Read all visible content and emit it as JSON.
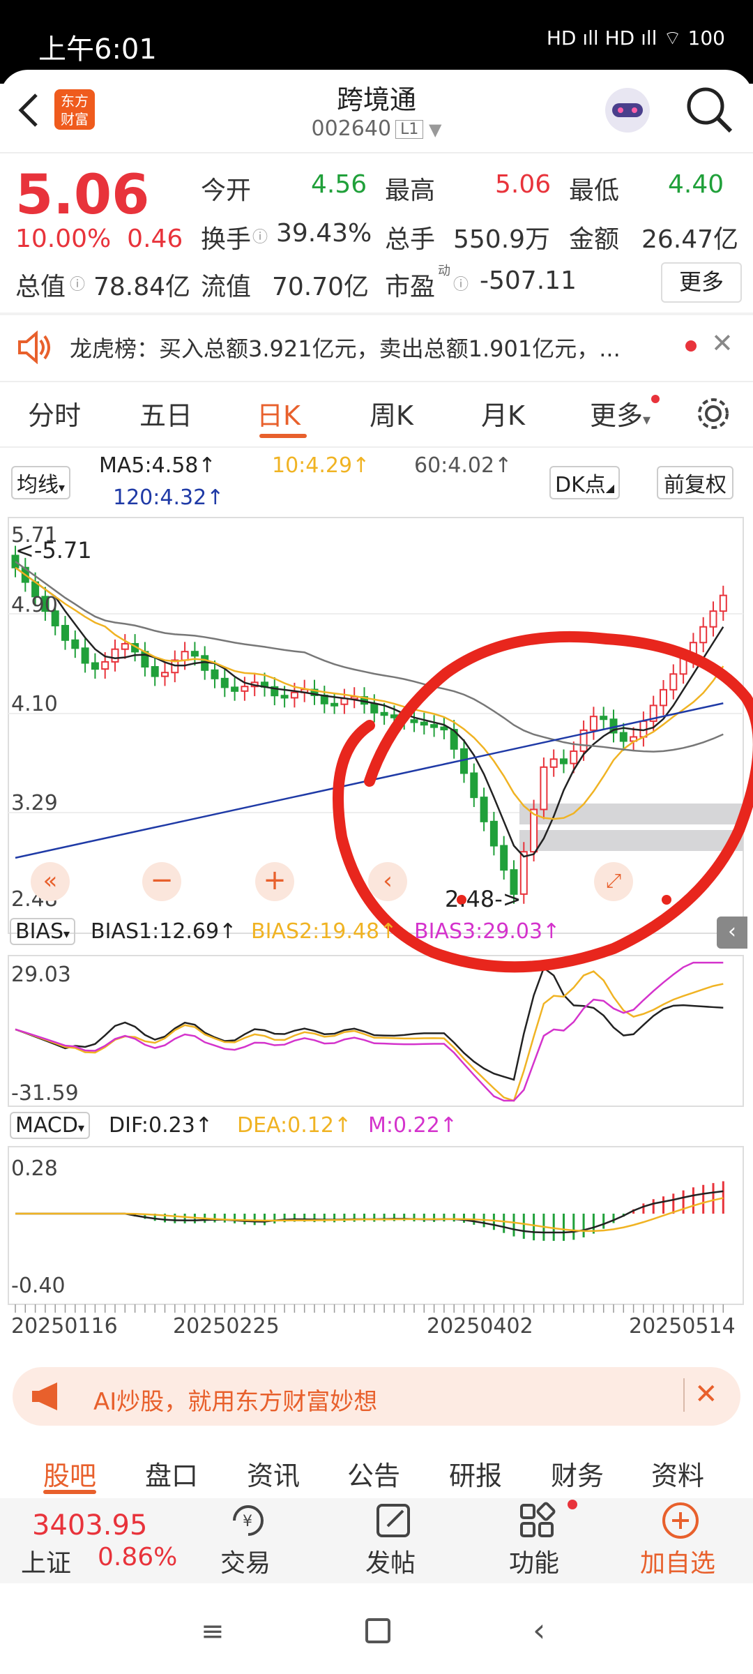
{
  "status": {
    "time": "上午6:01",
    "right": "HD ıll HD ıll ⌔ 100"
  },
  "header": {
    "logo_top": "东方",
    "logo_bottom": "财富",
    "title": "跨境通",
    "code": "002640",
    "level": "L1"
  },
  "quote": {
    "price": "5.06",
    "change_pct": "10.00%",
    "change": "0.46",
    "open_label": "今开",
    "open": "4.56",
    "high_label": "最高",
    "high": "5.06",
    "low_label": "最低",
    "low": "4.40",
    "turnover_label": "换手",
    "turnover": "39.43%",
    "volume_label": "总手",
    "volume": "550.9万",
    "amount_label": "金额",
    "amount": "26.47亿",
    "mktcap_label": "总值",
    "mktcap": "78.84亿",
    "float_label": "流值",
    "float": "70.70亿",
    "pe_label": "市盈",
    "pe_sup": "动",
    "pe": "-507.11",
    "more": "更多"
  },
  "news": {
    "text": "龙虎榜：买入总额3.921亿元，卖出总额1.901亿元，..."
  },
  "tabs": [
    "分时",
    "五日",
    "日K",
    "周K",
    "月K",
    "更多"
  ],
  "chart": {
    "ma_selector": "均线",
    "ma5": "MA5:4.58↑",
    "ma10": "10:4.29↑",
    "ma60": "60:4.02↑",
    "ma120": "120:4.32↑",
    "dk": "DK点",
    "adjust": "前复权",
    "yticks": [
      "5.71",
      "4.90",
      "4.10",
      "3.29",
      "2.48"
    ],
    "high_marker": "<-5.71",
    "low_marker": "2.48->",
    "bias_selector": "BIAS",
    "bias1": "BIAS1:12.69↑",
    "bias2": "BIAS2:19.48↑",
    "bias3": "BIAS3:29.03↑",
    "bias_top": "29.03",
    "bias_bottom": "-31.59",
    "macd_selector": "MACD",
    "dif": "DIF:0.23↑",
    "dea": "DEA:0.12↑",
    "m": "M:0.22↑",
    "macd_top": "0.28",
    "macd_bottom": "-0.40",
    "dates": [
      "20250116",
      "20250225",
      "20250402",
      "20250514"
    ],
    "colors": {
      "up": "#e8333b",
      "down": "#20a03a",
      "ma5": "#222222",
      "ma10": "#f0b323",
      "ma60": "#777777",
      "ma120": "#1f3aa6",
      "bias3": "#d433cc"
    }
  },
  "ai_banner": {
    "text": "AI炒股，就用东方财富妙想"
  },
  "bottom_tabs": [
    "股吧",
    "盘口",
    "资讯",
    "公告",
    "研报",
    "财务",
    "资料"
  ],
  "bottom_bar": {
    "index_value": "3403.95",
    "index_name": "上证",
    "index_change": "0.86%",
    "trade": "交易",
    "post": "发帖",
    "func": "功能",
    "add": "加自选"
  }
}
